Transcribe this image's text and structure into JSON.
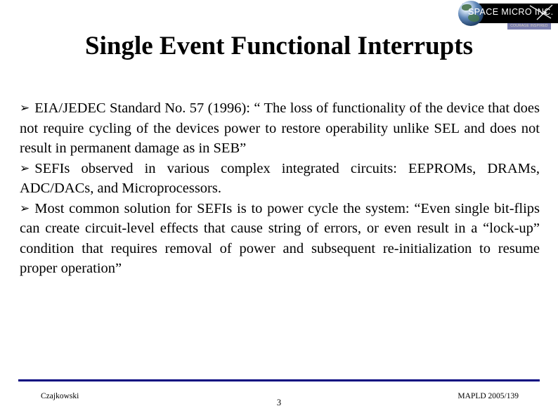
{
  "slide": {
    "title": "Single Event Functional Interrupts",
    "bullet_glyph": "➢",
    "paragraphs": [
      {
        "bulleted": true,
        "text": "EIA/JEDEC Standard No. 57 (1996): “ The loss of functionality of the device that does not require cycling of the devices power to restore operability unlike SEL and  does not result in permanent damage as in SEB”"
      },
      {
        "bulleted": true,
        "text": "SEFIs observed in various complex integrated circuits: EEPROMs, DRAMs, ADC/DACs, and Microprocessors."
      },
      {
        "bulleted": true,
        "text": "Most common solution for SEFIs is to power cycle the system: “Even single bit-flips can create circuit-level effects that cause string of errors, or even result in a “lock-up” condition that requires removal of power and subsequent re-initialization to resume proper operation”"
      }
    ]
  },
  "logo": {
    "company_name": "SPACE MICRO INC.",
    "tagline": "COURAGE INSPIRED",
    "globe_icon": "earth-globe-icon",
    "spacecraft_icon": "spacecraft-icon"
  },
  "footer": {
    "author": "Czajkowski",
    "page_number": "3",
    "conference_id": "MAPLD 2005/139",
    "rule_color": "#00007f"
  }
}
